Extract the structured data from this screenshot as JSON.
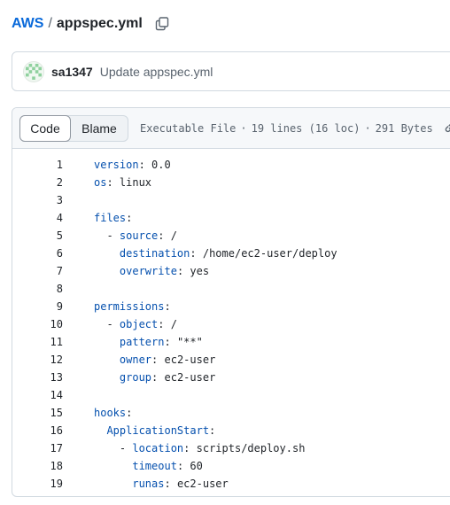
{
  "breadcrumb": {
    "repo": "AWS",
    "separator": "/",
    "file": "appspec.yml"
  },
  "commit": {
    "author": "sa1347",
    "message": "Update appspec.yml"
  },
  "file_header": {
    "tabs": [
      "Code",
      "Blame"
    ],
    "active_tab": "Code",
    "file_type": "Executable File",
    "lines_info": "19 lines (16 loc)",
    "size": "291 Bytes",
    "separator": "·"
  },
  "code_lines": [
    {
      "n": "1",
      "indent": "",
      "key": "version",
      "val": " 0.0"
    },
    {
      "n": "2",
      "indent": "",
      "key": "os",
      "val": " linux"
    },
    {
      "n": "3",
      "indent": "",
      "key": "",
      "val": ""
    },
    {
      "n": "4",
      "indent": "",
      "key": "files",
      "val": ""
    },
    {
      "n": "5",
      "indent": "  - ",
      "key": "source",
      "val": " /"
    },
    {
      "n": "6",
      "indent": "    ",
      "key": "destination",
      "val": " /home/ec2-user/deploy"
    },
    {
      "n": "7",
      "indent": "    ",
      "key": "overwrite",
      "val": " yes"
    },
    {
      "n": "8",
      "indent": "",
      "key": "",
      "val": ""
    },
    {
      "n": "9",
      "indent": "",
      "key": "permissions",
      "val": ""
    },
    {
      "n": "10",
      "indent": "  - ",
      "key": "object",
      "val": " /"
    },
    {
      "n": "11",
      "indent": "    ",
      "key": "pattern",
      "val": " \"**\""
    },
    {
      "n": "12",
      "indent": "    ",
      "key": "owner",
      "val": " ec2-user"
    },
    {
      "n": "13",
      "indent": "    ",
      "key": "group",
      "val": " ec2-user"
    },
    {
      "n": "14",
      "indent": "",
      "key": "",
      "val": ""
    },
    {
      "n": "15",
      "indent": "",
      "key": "hooks",
      "val": ""
    },
    {
      "n": "16",
      "indent": "  ",
      "key": "ApplicationStart",
      "val": ""
    },
    {
      "n": "17",
      "indent": "    - ",
      "key": "location",
      "val": " scripts/deploy.sh"
    },
    {
      "n": "18",
      "indent": "      ",
      "key": "timeout",
      "val": " 60"
    },
    {
      "n": "19",
      "indent": "      ",
      "key": "runas",
      "val": " ec2-user"
    }
  ],
  "icons": {
    "copy": "copy-icon",
    "avatar": "identicon",
    "raw": "link-icon"
  },
  "colors": {
    "link": "#0969da",
    "yaml_key": "#0550ae",
    "muted": "#59636e",
    "border": "#d1d9e0"
  }
}
